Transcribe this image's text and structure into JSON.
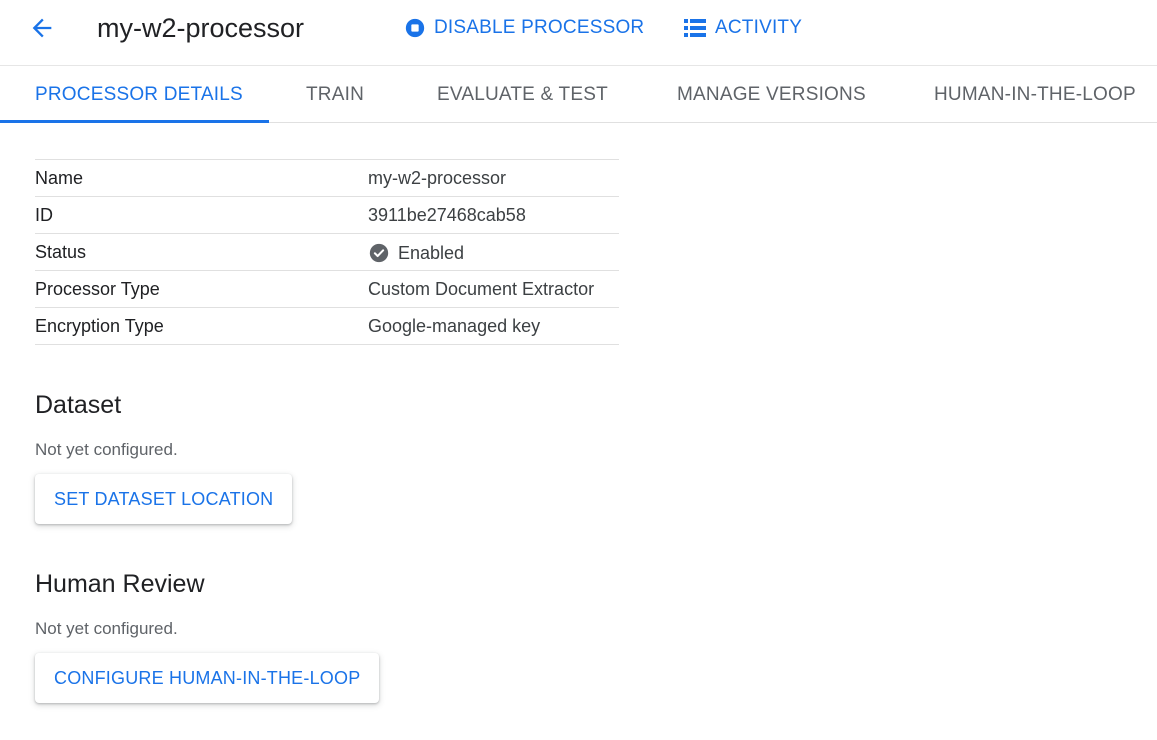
{
  "header": {
    "title": "my-w2-processor",
    "disable_label": "DISABLE PROCESSOR",
    "activity_label": "ACTIVITY"
  },
  "tabs": [
    {
      "label": "PROCESSOR DETAILS",
      "active": true
    },
    {
      "label": "TRAIN",
      "active": false
    },
    {
      "label": "EVALUATE & TEST",
      "active": false
    },
    {
      "label": "MANAGE VERSIONS",
      "active": false
    },
    {
      "label": "HUMAN-IN-THE-LOOP",
      "active": false
    }
  ],
  "details": [
    {
      "label": "Name",
      "value": "my-w2-processor"
    },
    {
      "label": "ID",
      "value": "3911be27468cab58"
    },
    {
      "label": "Status",
      "value": "Enabled"
    },
    {
      "label": "Processor Type",
      "value": "Custom Document Extractor"
    },
    {
      "label": "Encryption Type",
      "value": "Google-managed key"
    }
  ],
  "dataset": {
    "title": "Dataset",
    "text": "Not yet configured.",
    "button": "SET DATASET LOCATION"
  },
  "human_review": {
    "title": "Human Review",
    "text": "Not yet configured.",
    "button": "CONFIGURE HUMAN-IN-THE-LOOP"
  },
  "icons": {
    "back": "arrow-back-icon",
    "disable": "stop-circle-icon",
    "activity": "list-icon",
    "status": "check-circle-icon"
  },
  "colors": {
    "accent": "#1a73e8",
    "status_icon": "#5f6368"
  }
}
